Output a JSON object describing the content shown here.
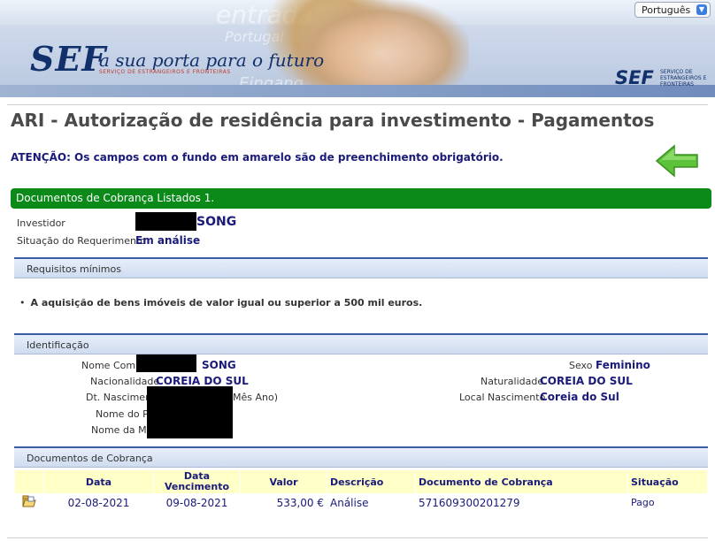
{
  "header": {
    "logo_text": "SEF",
    "slogan": "a sua porta para o futuro",
    "subtitle": "SERVIÇO DE ESTRANGEIROS E FRONTEIRAS",
    "small_logo_text": "SEF",
    "small_logo_sub": "SERVIÇO DE ESTRANGEIROS E FRONTEIRAS",
    "language": "Português",
    "bg_words": [
      "entrada",
      "Portugal",
      "Eingang"
    ]
  },
  "page": {
    "title": "ARI - Autorização de residência para investimento - Pagamentos",
    "attention": "ATENÇÃO: Os campos com o fundo em amarelo são de preenchimento obrigatório.",
    "listed_banner": "Documentos de Cobrança Listados 1."
  },
  "summary": {
    "investor_label": "Investidor",
    "investor_value": "SONG",
    "status_label": "Situação do Requerimento",
    "status_value": "Em análise"
  },
  "requirements": {
    "header": "Requisitos mínimos",
    "items": [
      "A aquisição de bens imóveis de valor igual ou superior a 500 mil euros."
    ]
  },
  "identification": {
    "header": "Identificação",
    "name_label": "Nome Comp",
    "name_value": "SONG",
    "nationality_label": "Nacionalidade",
    "nationality_value": "COREIA DO SUL",
    "birth_label": "Dt. Nascimen",
    "birth_hint": "Mês Ano)",
    "father_label": "Nome do Pa",
    "mother_label": "Nome da Mã",
    "sex_label": "Sexo",
    "sex_value": "Feminino",
    "naturality_label": "Naturalidade",
    "naturality_value": "COREIA DO SUL",
    "birthplace_label": "Local Nascimento",
    "birthplace_value": "Coreia do Sul"
  },
  "billing": {
    "header": "Documentos de Cobrança",
    "columns": [
      "Data",
      "Data Vencimento",
      "Valor",
      "Descrição",
      "Documento de Cobrança",
      "Situação"
    ],
    "rows": [
      {
        "date": "02-08-2021",
        "due": "09-08-2021",
        "value": "533,00 €",
        "description": "Análise",
        "document": "571609300201279",
        "status": "Pago"
      }
    ]
  },
  "colors": {
    "accent_green": "#0b8a1a",
    "navy": "#1a1a7a",
    "required_yellow": "#ffffc8"
  }
}
